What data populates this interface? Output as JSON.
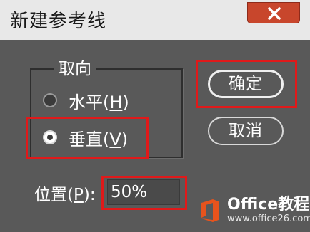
{
  "dialog": {
    "title": "新建参考线",
    "close_label": "×"
  },
  "orientation": {
    "legend": "取向",
    "options": [
      {
        "text": "水平(",
        "key": "H",
        "suffix": ")",
        "selected": false
      },
      {
        "text": "垂直(",
        "key": "V",
        "suffix": ")",
        "selected": true
      }
    ]
  },
  "buttons": {
    "ok_label": "确定",
    "cancel_label": "取消"
  },
  "position": {
    "label_text": "位置(",
    "label_key": "P",
    "label_suffix": "):",
    "value": "50%"
  },
  "watermark": {
    "title": "Office教程网",
    "url": "www.office26.com"
  },
  "colors": {
    "dialog_bg": "#595959",
    "titlebar_bg": "#e8e8e8",
    "close_bg": "#c8462c",
    "highlight": "#e0191a",
    "logo_orange": "#e8531c"
  }
}
